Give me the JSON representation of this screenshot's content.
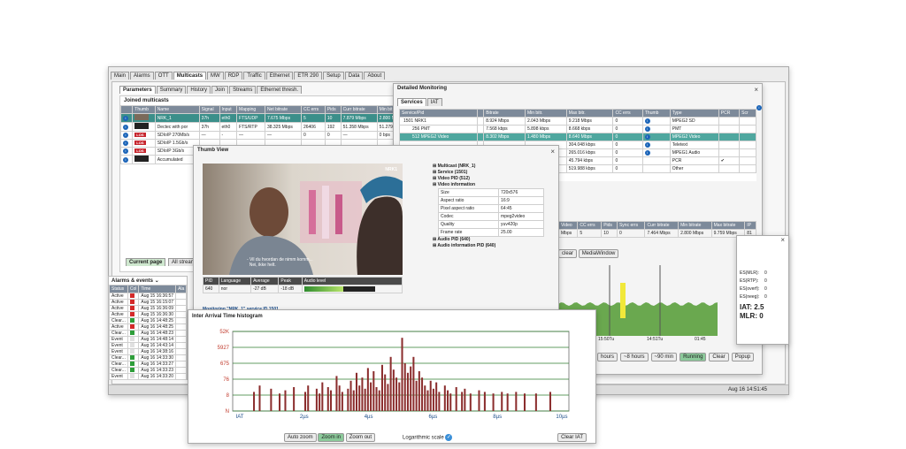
{
  "main_tabs": [
    "Main",
    "Alarms",
    "OTT",
    "Multicasts",
    "MW",
    "RDP",
    "Traffic",
    "Ethernet",
    "ETR 290",
    "Setup",
    "Data",
    "About"
  ],
  "sub_tabs": [
    "Parameters",
    "Summary",
    "History",
    "Join",
    "Streams",
    "Ethernet thresh."
  ],
  "joined": {
    "title": "Joined multicasts",
    "headers": [
      "",
      "Thumb",
      "Name",
      "Signal",
      "Input",
      "Mapping",
      "Net bitrate",
      "CC errs",
      "Pids",
      "Curr bitrate",
      "Min bit"
    ],
    "rows": [
      {
        "name": "NRK_1",
        "signal": "37h",
        "input": "eth0",
        "mapping": "FTS/UDP",
        "net": "7.675 Mbps",
        "cc": "5",
        "pids": "10",
        "cur": "7.879 Mbps",
        "min": "2.800 N",
        "thumb": "img",
        "sel": true
      },
      {
        "name": "Dectec with por",
        "signal": "37h",
        "input": "eth0",
        "mapping": "FTS/RTP",
        "net": "38.325 Mbps",
        "cc": "26406",
        "pids": "192",
        "cur": "51.358 Mbps",
        "min": "51.279",
        "thumb": "dark"
      },
      {
        "name": "SDIoIP 270Mb/s",
        "signal": "—",
        "input": "-",
        "mapping": "—",
        "net": "—",
        "cc": "0",
        "pids": "0",
        "cur": "—",
        "min": "0 bps",
        "thumb": "los"
      },
      {
        "name": "SDIoIP 1.5Gb/s",
        "signal": "",
        "input": "",
        "mapping": "",
        "net": "",
        "cc": "",
        "pids": "",
        "cur": "",
        "min": "",
        "thumb": "los"
      },
      {
        "name": "SDIoIP 3Gb/s",
        "signal": "",
        "input": "",
        "mapping": "",
        "net": "",
        "cc": "",
        "pids": "",
        "cur": "",
        "min": "",
        "thumb": "los"
      },
      {
        "name": "Accumulated",
        "signal": "",
        "input": "",
        "mapping": "",
        "net": "",
        "cc": "",
        "pids": "",
        "cur": "",
        "min": "",
        "thumb": "dark"
      }
    ]
  },
  "bottom_tabs": {
    "current": "Current page",
    "all": "All streams (effe"
  },
  "alarms": {
    "title": "Alarms & events",
    "headers": [
      "Status",
      "Col",
      "Time",
      "Ala"
    ],
    "rows": [
      {
        "status": "Active",
        "color": "#d42a2a",
        "time": "Aug 15 16:36:57"
      },
      {
        "status": "Active",
        "color": "#d42a2a",
        "time": "Aug 15 16:15:07"
      },
      {
        "status": "Active",
        "color": "#d42a2a",
        "time": "Aug 15 16:36:09"
      },
      {
        "status": "Active",
        "color": "#d42a2a",
        "time": "Aug 15 16:36:30"
      },
      {
        "status": "Clear...",
        "color": "#2e9e3a",
        "time": "Aug 16 14:48:25"
      },
      {
        "status": "Active",
        "color": "#d42a2a",
        "time": "Aug 16 14:48:25"
      },
      {
        "status": "Clear...",
        "color": "#2e9e3a",
        "time": "Aug 16 14:48:23"
      },
      {
        "status": "Event",
        "color": "#e0e0e0",
        "time": "Aug 16 14:48:14"
      },
      {
        "status": "Event",
        "color": "#e0e0e0",
        "time": "Aug 16 14:43:14"
      },
      {
        "status": "Event",
        "color": "#e0e0e0",
        "time": "Aug 16 14:38:16"
      },
      {
        "status": "Clear...",
        "color": "#2e9e3a",
        "time": "Aug 16 14:33:30"
      },
      {
        "status": "Clear...",
        "color": "#2e9e3a",
        "time": "Aug 16 14:33:27"
      },
      {
        "status": "Clear...",
        "color": "#2e9e3a",
        "time": "Aug 16 14:33:23"
      },
      {
        "status": "Event",
        "color": "#e0e0e0",
        "time": "Aug 16 14:33:20"
      }
    ]
  },
  "status_time": "Aug 16 14:51:45",
  "detailed": {
    "title": "Detailed Monitoring",
    "tabs": [
      "Services",
      "IAT"
    ],
    "headers": [
      "Service/Pid",
      "",
      "Bitrate",
      "Min bitr.",
      "Max bitr.",
      "CC errs",
      "Thumb",
      "Type",
      "PCR",
      "Scr"
    ],
    "rows": [
      {
        "name": "1501 NRK1",
        "bit": "8.924 Mbps",
        "min": "2.043 Mbps",
        "max": "9.218 Mbps",
        "cc": "0",
        "type": "MPEG2 SD",
        "pcr": "",
        "cls": ""
      },
      {
        "name": "256 PMT",
        "bit": "7.568 kbps",
        "min": "5.898 kbps",
        "max": "8.668 kbps",
        "cc": "0",
        "type": "PMT",
        "pcr": "",
        "cls": ""
      },
      {
        "name": "512 MPEG2 Video",
        "bit": "8.302 Mbps",
        "min": "1.480 Mbps",
        "max": "8.640 Mbps",
        "cc": "0",
        "type": "MPEG2 Video",
        "pcr": "",
        "cls": "green"
      },
      {
        "name": "",
        "bit": "",
        "min": "",
        "max": "304.048 kbps",
        "cc": "0",
        "type": "Teletext",
        "pcr": "",
        "cls": ""
      },
      {
        "name": "",
        "bit": "",
        "min": "",
        "max": "265.016 kbps",
        "cc": "0",
        "type": "MPEG1 Audio",
        "pcr": "",
        "cls": ""
      },
      {
        "name": "",
        "bit": "",
        "min": "",
        "max": "45.794 kbps",
        "cc": "0",
        "type": "PCR",
        "pcr": "✔",
        "cls": ""
      },
      {
        "name": "",
        "bit": "",
        "min": "",
        "max": "519.988 kbps",
        "cc": "0",
        "type": "Other",
        "pcr": "",
        "cls": ""
      }
    ],
    "headers2": [
      "Video",
      "CC errs",
      "Pids",
      "Sync errs",
      "Curr bitrate",
      "Min bitrate",
      "Max bitrate",
      "IP"
    ],
    "row2": [
      "Mbps",
      "5",
      "10",
      "0",
      "7.464 Mbps",
      "2.800 Mbps",
      "9.759 Mbps",
      "81"
    ],
    "buttons": [
      "clear",
      "MediaWindow"
    ],
    "graph_times": [
      "15:50Tu",
      "14:51Tu",
      "01:45"
    ],
    "range_buttons": [
      "hours",
      "~8 hours",
      "~90 min",
      "Running",
      "Clear",
      "Popup"
    ]
  },
  "mlr": {
    "labels": [
      "ES(MLR):",
      "ES(RTP):",
      "ES(overf):",
      "ES(neeg):"
    ],
    "values": [
      "0",
      "0",
      "0",
      "0"
    ],
    "iat": "IAT: 2.5",
    "mlr": "MLR: 0",
    "right_vals": [
      "0",
      "0",
      "1",
      "0"
    ]
  },
  "thumb": {
    "title": "Thumb View",
    "subtitle": "- Vil du hvordan de nimm komm...\n  Nei, ikke helt.",
    "logo": "NRK1",
    "tree": [
      {
        "label": "Multicast (NRK_1)",
        "bold": true
      },
      {
        "label": "Service (1501)",
        "bold": true
      },
      {
        "label": "Video PID (512)",
        "bold": true
      },
      {
        "label": "Video information",
        "bold": true
      }
    ],
    "props": [
      [
        "Size",
        "720x576"
      ],
      [
        "Aspect ratio",
        "16:9"
      ],
      [
        "Pixel aspect ratio",
        "64:45"
      ],
      [
        "Codec",
        "mpeg2video"
      ],
      [
        "Quality",
        "yuv420p"
      ],
      [
        "Frame rate",
        "25.00"
      ]
    ],
    "tree2": [
      {
        "label": "Audio PID (640)"
      },
      {
        "label": "Audio information PID (640)"
      }
    ],
    "audio_headers": [
      "PID",
      "Language",
      "Average",
      "Peak",
      "Audio level"
    ],
    "audio_row": [
      "640",
      "nor",
      "-27 dB",
      "-18 dB"
    ],
    "audio_level": 0.55,
    "monitoring": "Monitoring \"NRK_1\" service ID 1501."
  },
  "iat": {
    "title": "Inter Arrival Time histogram",
    "buttons": [
      "Auto zoom",
      "Zoom in",
      "Zoom out"
    ],
    "log_label": "Logarithmic scale",
    "clear": "Clear IAT"
  },
  "chart_data": {
    "type": "bar",
    "title": "Inter Arrival Time histogram",
    "y_ticks": [
      "52K",
      "5927",
      "675",
      "76",
      "8",
      "N"
    ],
    "x_ticks": [
      "IAT",
      "2µs",
      "4µs",
      "6µs",
      "8µs",
      "10µs"
    ],
    "log_scale": true,
    "values": [
      0,
      0,
      0,
      0,
      0,
      0,
      0,
      1.2,
      0,
      1.6,
      0,
      0,
      0,
      1.4,
      0,
      0,
      1.1,
      0,
      1.3,
      0,
      0,
      1.5,
      0,
      0,
      0,
      1.2,
      1.6,
      0,
      0,
      1.4,
      1.1,
      1.8,
      0,
      1.5,
      1.3,
      0,
      2.2,
      1.6,
      1.2,
      0,
      1.4,
      1.9,
      1.3,
      2.4,
      1.6,
      2.1,
      1.4,
      2.7,
      1.8,
      2.5,
      1.5,
      1.3,
      2.9,
      2.3,
      1.7,
      3.4,
      2.6,
      2.1,
      1.8,
      4.6,
      3.0,
      2.4,
      2.8,
      3.4,
      1.9,
      2.5,
      2.1,
      1.6,
      1.3,
      1.9,
      1.4,
      1.8,
      1.2,
      0,
      1.6,
      1.3,
      1.1,
      0,
      1.5,
      0,
      1.2,
      1.4,
      0,
      1.1,
      0,
      0,
      1.3,
      0,
      1.2,
      0,
      0,
      1.1,
      0,
      0,
      1.2,
      0,
      1.1,
      0,
      0,
      1.2,
      0,
      0,
      1.1,
      0,
      0,
      0,
      1.1,
      0,
      0,
      0,
      0,
      1.2,
      0,
      0,
      0,
      0,
      0,
      0
    ]
  }
}
